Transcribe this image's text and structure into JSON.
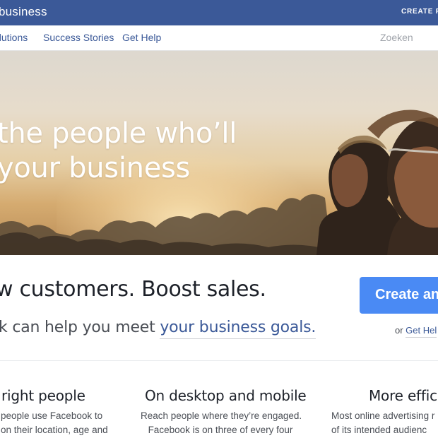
{
  "header": {
    "brand": "business",
    "create_link": "CREATE P"
  },
  "nav": {
    "items": [
      {
        "label": "olutions"
      },
      {
        "label": "Success Stories"
      },
      {
        "label": "Get Help"
      }
    ],
    "search_label": "Zoeken"
  },
  "hero": {
    "line1": "the people who’ll",
    "line2": "your business"
  },
  "main": {
    "headline": "w customers. Boost sales.",
    "subline_prefix": "k can help you meet ",
    "subline_link": "your business goals.",
    "create_button": "Create an",
    "or_text": "or ",
    "get_help_link": "Get Hel"
  },
  "features": [
    {
      "title": "right people",
      "lines": [
        "people use Facebook to",
        "on their location, age and"
      ]
    },
    {
      "title": "On desktop and mobile",
      "lines": [
        "Reach people where they’re engaged.",
        "Facebook is on three of every four"
      ]
    },
    {
      "title": "More effici",
      "lines": [
        "Most online advertising r",
        "of its intended audienc"
      ]
    }
  ],
  "colors": {
    "brand_blue": "#3b5998",
    "button_blue": "#4a8af4"
  }
}
